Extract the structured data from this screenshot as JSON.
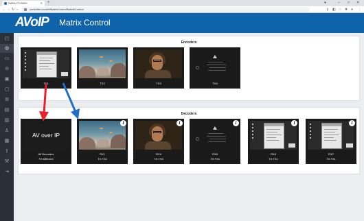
{
  "browser": {
    "tab_title": "SWM-CTL9000",
    "new_tab": "+",
    "url": "controller.local/#/MatrixControl/MatrixControl"
  },
  "app": {
    "logo": "AVoIP",
    "title": "Matrix Control"
  },
  "sidebar": {
    "items": [
      {
        "icon": "dashboard-icon"
      },
      {
        "icon": "matrix-control-icon",
        "active": true
      },
      {
        "icon": "devices-icon"
      },
      {
        "icon": "network-icon"
      },
      {
        "icon": "display-icon"
      },
      {
        "icon": "monitor-icon"
      },
      {
        "icon": "settings-icon"
      },
      {
        "icon": "video-wall-icon"
      },
      {
        "icon": "layers-icon"
      },
      {
        "icon": "user-icon"
      },
      {
        "icon": "clipboard-icon"
      },
      {
        "icon": "upload-icon"
      },
      {
        "icon": "wrench-icon"
      },
      {
        "icon": "logout-icon"
      }
    ]
  },
  "encoders": {
    "title": "Encoders",
    "cards": [
      {
        "label": "TX1",
        "thumb": "desktop"
      },
      {
        "label": "TX2",
        "thumb": "aquarium"
      },
      {
        "label": "TX3",
        "thumb": "person"
      },
      {
        "label": "TX4",
        "thumb": "nosignal"
      }
    ]
  },
  "decoders": {
    "title": "Decoders",
    "cards": [
      {
        "label": "All Decoders",
        "sub": "TX:Different",
        "thumb": "avip",
        "thumb_text": "AV over IP"
      },
      {
        "label": "RX1",
        "sub": "TX:TX2",
        "thumb": "aquarium"
      },
      {
        "label": "RX4",
        "sub": "TX:TX3",
        "thumb": "person"
      },
      {
        "label": "RX5",
        "sub": "TX:TX4",
        "thumb": "nosignal"
      },
      {
        "label": "RX6",
        "sub": "TX:TX1",
        "thumb": "desktop"
      },
      {
        "label": "RX7",
        "sub": "TX:TX1",
        "thumb": "desktop"
      }
    ]
  },
  "colors": {
    "header": "#0e63aa",
    "sidebar": "#2b3038",
    "arrow_red": "#e8202a",
    "arrow_blue": "#1e6fc8"
  }
}
